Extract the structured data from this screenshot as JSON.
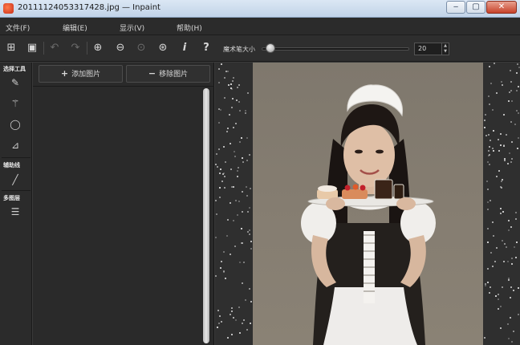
{
  "window": {
    "title": "20111124053317428.jpg — Inpaint",
    "controls": {
      "minimize": "‒",
      "maximize": "▢",
      "close": "✕"
    }
  },
  "menu": [
    "文件(F)",
    "编辑(E)",
    "显示(V)",
    "帮助(H)"
  ],
  "toolbar": {
    "icons": [
      "open-icon",
      "save-icon",
      "undo-icon",
      "redo-icon",
      "zoom-in-icon",
      "zoom-out-icon",
      "zoom-actual-icon",
      "zoom-fit-icon",
      "info-icon",
      "help-icon"
    ],
    "brush_size_label": "魔术笔大小",
    "brush_size_value": "20"
  },
  "tools": {
    "selection_heading": "选择工具",
    "guide_heading": "辅助线",
    "layer_heading": "多图层"
  },
  "panel": {
    "add_image": "添加图片",
    "remove_image": "移除图片"
  },
  "colors": {
    "accent_close": "#c7422a",
    "background": "#2f2f2f",
    "photo_backdrop": "#857d71"
  }
}
